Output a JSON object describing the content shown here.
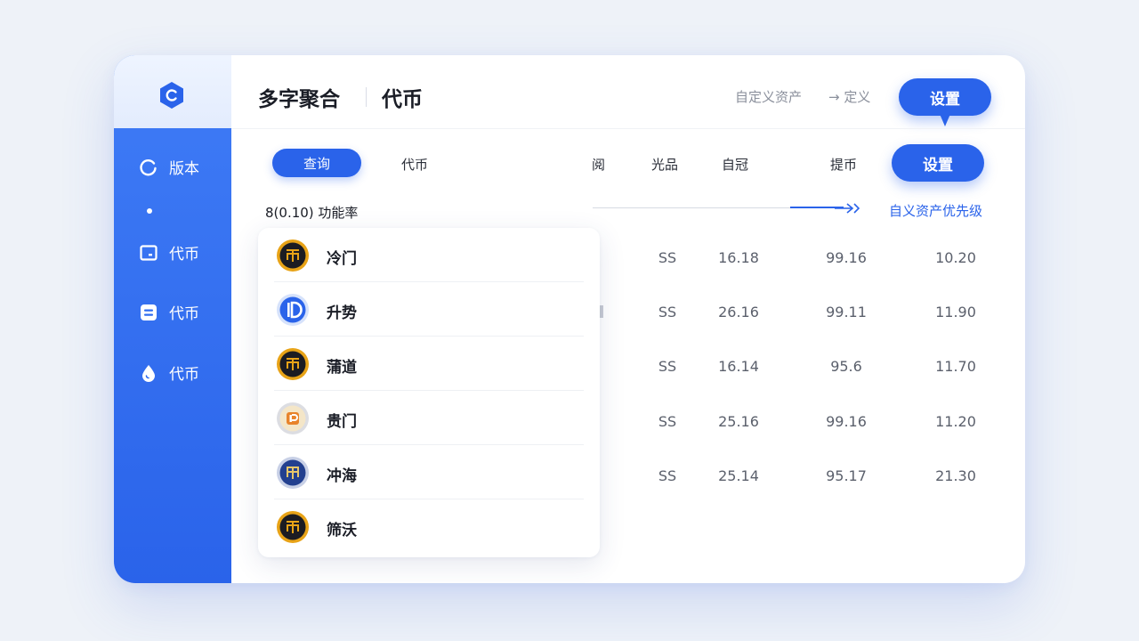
{
  "header": {
    "title": "多字聚合",
    "subtitle": "代币",
    "link_custom_asset": "自定义资产",
    "link_redefine": "→ 定义",
    "settings_label": "设置"
  },
  "sidebar": {
    "items": [
      {
        "label": "版本",
        "icon": "refresh-icon"
      },
      {
        "label": "代币",
        "icon": "wallet-icon"
      },
      {
        "label": "代币",
        "icon": "list-icon"
      },
      {
        "label": "代币",
        "icon": "drop-icon"
      }
    ]
  },
  "toolbar": {
    "query_label": "查询",
    "token_tab": "代币",
    "settings_label": "设置",
    "columns": [
      "阅",
      "光品",
      "自冠",
      "提币"
    ]
  },
  "info": {
    "text": "8(0.10) 功能率",
    "priority_link": "自义资产优先级"
  },
  "coins": [
    {
      "name": "冷门",
      "col1": "SS",
      "col2": "16.18",
      "col3": "99.16",
      "col4": "10.20"
    },
    {
      "name": "升势",
      "col1": "SS",
      "col2": "26.16",
      "col3": "99.11",
      "col4": "11.90"
    },
    {
      "name": "蒲道",
      "col1": "SS",
      "col2": "16.14",
      "col3": "95.6",
      "col4": "11.70"
    },
    {
      "name": "贵门",
      "col1": "SS",
      "col2": "25.16",
      "col3": "99.16",
      "col4": "11.20"
    },
    {
      "name": "冲海",
      "col1": "SS",
      "col2": "25.14",
      "col3": "95.17",
      "col4": "21.30"
    },
    {
      "name": "筛沃",
      "col1": "",
      "col2": "",
      "col3": "",
      "col4": ""
    }
  ],
  "colors": {
    "accent": "#2a63ea",
    "sidebar_top": "#e3ecfd",
    "coin_gold": "#e8a317",
    "coin_blue": "#2a63ea"
  }
}
